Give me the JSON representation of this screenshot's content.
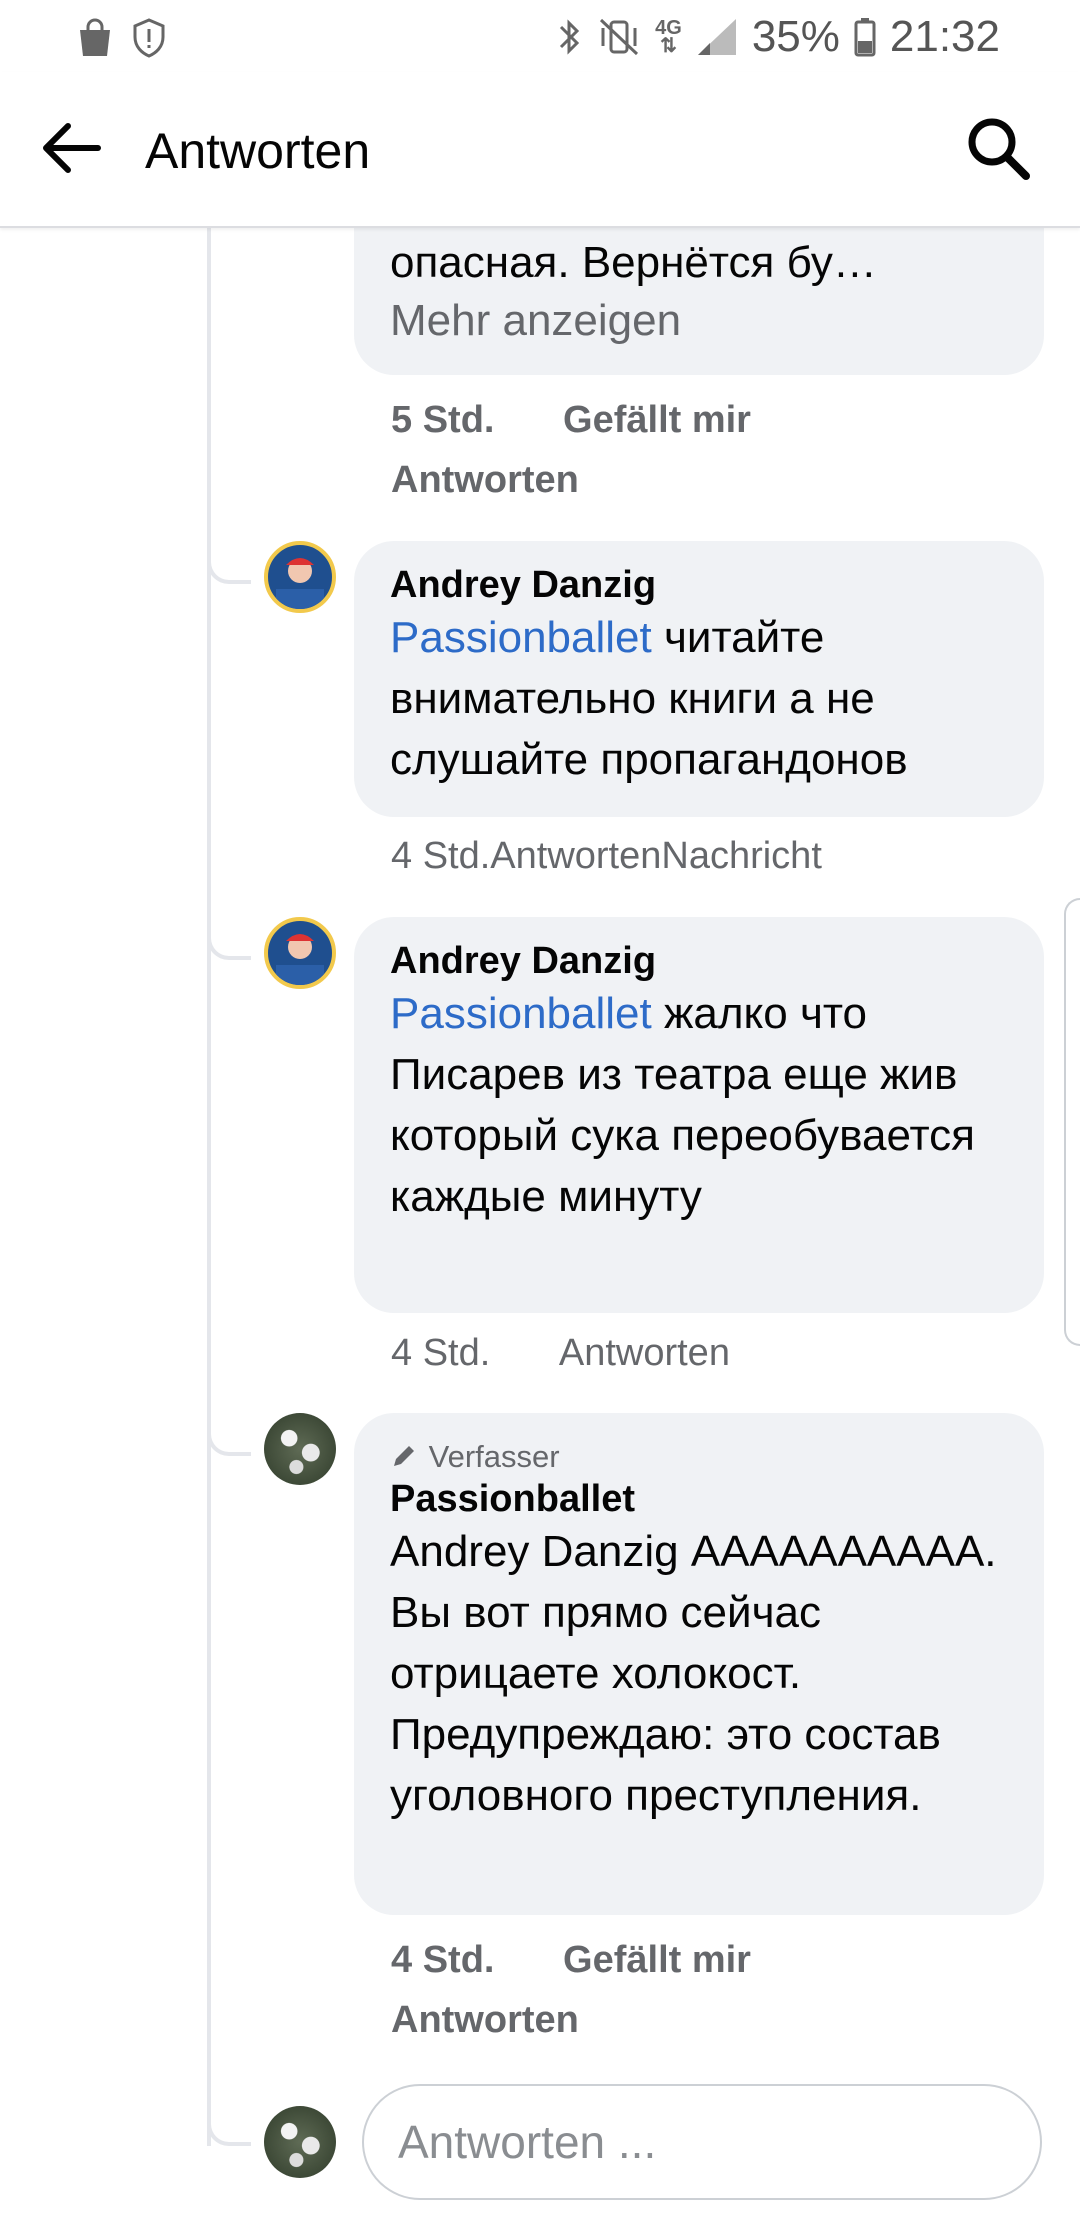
{
  "status_bar": {
    "battery": "35%",
    "time": "21:32",
    "network": "4G",
    "left_icons": [
      "shopping-bag-icon",
      "shield-alert-icon"
    ],
    "right_icons": [
      "bluetooth-icon",
      "vibrate-mute-icon",
      "signal-icon",
      "battery-icon"
    ]
  },
  "app_bar": {
    "title": "Antworten"
  },
  "comments": [
    {
      "text_tail": "опасная. Вернётся бу…",
      "more": "Mehr anzeigen",
      "time": "5 Std.",
      "like": "Gefällt mir",
      "reply": "Antworten"
    },
    {
      "author": "Andrey Danzig",
      "mention": "Passionballet",
      "text": " читайте внимательно книги а не слушайте пропагандонов",
      "meta": "4 Std.AntwortenNachricht"
    },
    {
      "author": "Andrey Danzig",
      "mention": "Passionballet",
      "text": " жалко что Писарев из театра еще жив который сука переобувается каждые минуту",
      "time": "4 Std.",
      "reply": "Antworten"
    },
    {
      "badge": "Verfasser",
      "author": "Passionballet",
      "text": "Andrey Danzig АААААААААА. Вы вот прямо сейчас отрицаете холокост. Предупреждаю: это состав уголовного преступления.",
      "time": "4 Std.",
      "like": "Gefällt mir",
      "reply": "Antworten"
    }
  ],
  "reply_input": {
    "placeholder": "Antworten ..."
  }
}
